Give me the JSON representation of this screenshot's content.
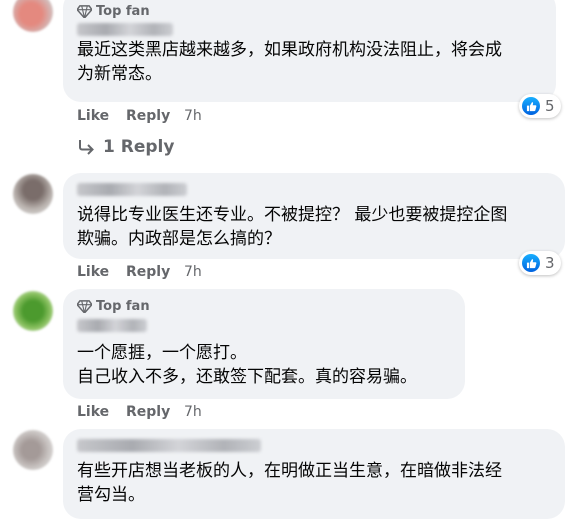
{
  "comments": [
    {
      "badge": "Top fan",
      "text": "最近这类黑店越来越多，如果政府机构没法阻止，将会成\n为新常态。",
      "actions": {
        "like": "Like",
        "reply": "Reply",
        "time": "7h"
      },
      "reaction_count": "5",
      "replies_link": "1 Reply"
    },
    {
      "badge": "",
      "text": "说得比专业医生还专业。不被提控？ 最少也要被提控企图\n欺骗。内政部是怎么搞的？",
      "actions": {
        "like": "Like",
        "reply": "Reply",
        "time": "7h"
      },
      "reaction_count": "3"
    },
    {
      "badge": "Top fan",
      "text": "一个愿捱，一个愿打。\n自己收入不多，还敢签下配套。真的容易骗。",
      "actions": {
        "like": "Like",
        "reply": "Reply",
        "time": "7h"
      }
    },
    {
      "badge": "",
      "text": "有些开店想当老板的人，在明做正当生意，在暗做非法经\n营勾当。"
    }
  ],
  "colors": {
    "bubble_bg": "#f0f2f5",
    "secondary_text": "#65676b",
    "like_blue": "#0866ff"
  },
  "icons": [
    "top-fan-diamond-icon",
    "like-thumb-icon",
    "reply-arrow-icon"
  ]
}
